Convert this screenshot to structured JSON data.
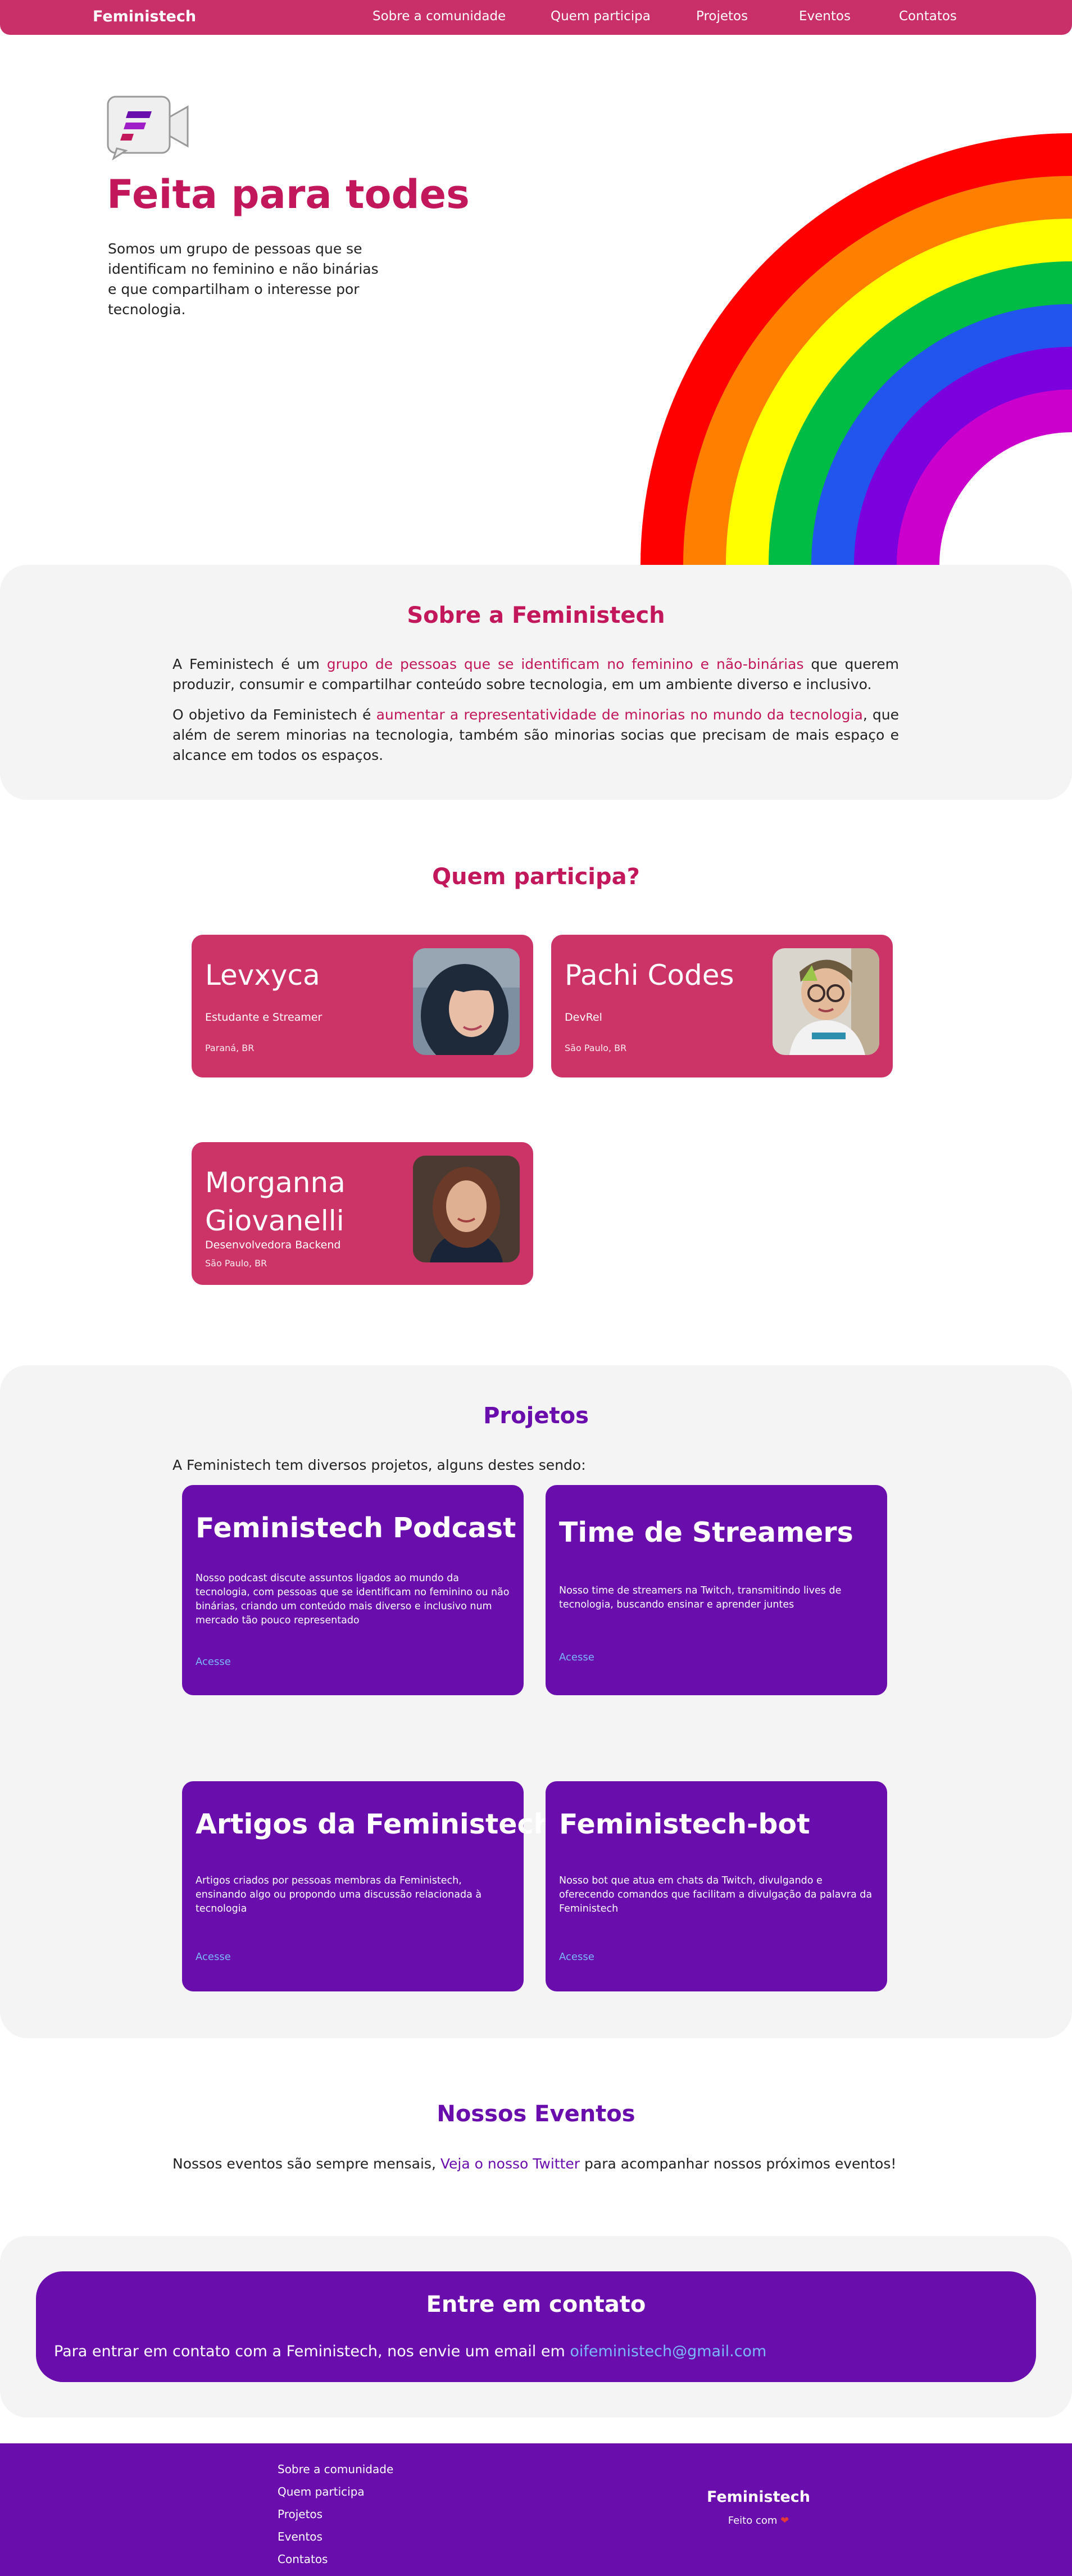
{
  "nav": {
    "brand": "Feministech",
    "links": [
      "Sobre a comunidade",
      "Quem participa",
      "Projetos",
      "Eventos",
      "Contatos"
    ]
  },
  "hero": {
    "title": "Feita para todes",
    "text": "Somos um grupo de pessoas que se identificam no feminino e não binárias e que compartilham o interesse por tecnologia."
  },
  "about": {
    "title": "Sobre a Feministech",
    "p1_start": "A Feministech é um ",
    "p1_highlight": "grupo de pessoas que se identificam no feminino e não-binárias",
    "p1_end": " que querem produzir, consumir e compartilhar conteúdo sobre tecnologia, em um ambiente diverso e inclusivo.",
    "p2_start": "O objetivo da Feministech é ",
    "p2_highlight": "aumentar a representatividade de minorias no mundo da tecnologia",
    "p2_end": ", que além de serem minorias na tecnologia, também são minorias socias que precisam de mais espaço e alcance em todos os espaços."
  },
  "members": {
    "title": "Quem participa?",
    "items": [
      {
        "name": "Levxyca",
        "role": "Estudante e Streamer",
        "location": "Paraná, BR"
      },
      {
        "name": "Pachi Codes",
        "role": "DevRel",
        "location": "São Paulo, BR"
      },
      {
        "name": "Morganna Giovanelli",
        "role": "Desenvolvedora Backend",
        "location": "São Paulo, BR"
      }
    ]
  },
  "projects": {
    "title": "Projetos",
    "intro": "A Feministech tem diversos projetos, alguns destes sendo:",
    "link_label": "Acesse",
    "items": [
      {
        "title": "Feministech Podcast",
        "desc": "Nosso podcast discute assuntos ligados ao mundo da tecnologia, com pessoas que se identificam no feminino ou não binárias, criando um conteúdo mais diverso e inclusivo num mercado tão pouco representado"
      },
      {
        "title": "Time de Streamers",
        "desc": "Nosso time de streamers na Twitch, transmitindo lives de tecnologia, buscando ensinar e aprender juntes"
      },
      {
        "title": "Artigos da Feministech",
        "desc": "Artigos criados por pessoas membras da Feministech, ensinando algo ou propondo uma discussão relacionada à tecnologia"
      },
      {
        "title": "Feministech-bot",
        "desc": "Nosso bot que atua em chats da Twitch, divulgando e oferecendo comandos que facilitam a divulgação da palavra da Feministech"
      }
    ]
  },
  "events": {
    "title": "Nossos Eventos",
    "text_start": "Nossos eventos são sempre mensais, ",
    "link": "Veja o nosso Twitter",
    "text_end": " para acompanhar nossos próximos eventos!"
  },
  "contact": {
    "title": "Entre em contato",
    "text": "Para entrar em contato com a Feministech, nos envie um email em ",
    "email": "oifeministech@gmail.com"
  },
  "footer": {
    "links": [
      "Sobre a comunidade",
      "Quem participa",
      "Projetos",
      "Eventos",
      "Contatos"
    ],
    "brand": "Feministech",
    "made_with": "Feito com"
  },
  "colors": {
    "nav_bg": "#c9306a",
    "accent_pink": "#c2185b",
    "member_card": "#cc3366",
    "purple": "#6a0dad",
    "link_blue": "#7ab8ff",
    "section_gray": "#f4f4f4"
  },
  "icons": [
    "video-chat-logo-icon",
    "heart-icon",
    "rainbow-illustration"
  ]
}
